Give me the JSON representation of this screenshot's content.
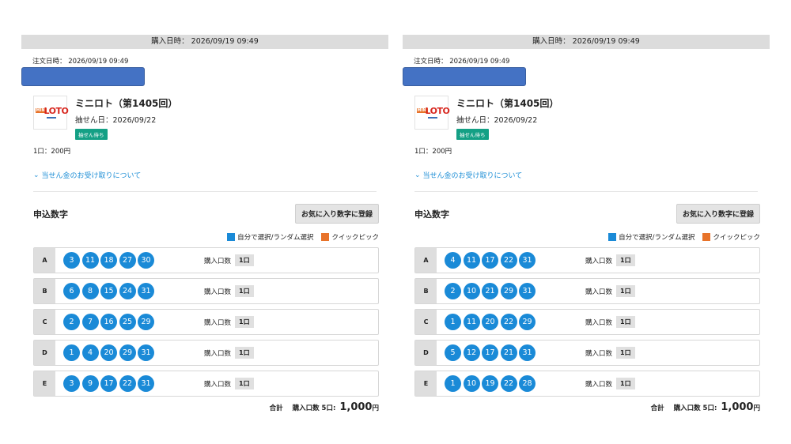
{
  "colors": {
    "ball": "#1a8ad7",
    "self_select": "#1a8ad7",
    "quick_pick": "#e8732a",
    "status_badge": "#14a085",
    "link": "#1f8fd6"
  },
  "panels": [
    {
      "purchase_datetime": "購入日時： 2026/09/19 09:49",
      "order_datetime": "注文日時： 2026/09/19 09:49",
      "logo_mini": "MINI",
      "logo_loto": "LOTO",
      "product_title": "ミニロト（第1405回）",
      "draw_date": "抽せん日：2026/09/22",
      "status": "抽せん待ち",
      "unit_price": "1口：200円",
      "prize_link": "当せん金のお受け取りについて",
      "section_title": "申込数字",
      "fav_button": "お気に入り数字に登録",
      "legend_self": "自分で選択/ランダム選択",
      "legend_quick": "クイックピック",
      "rows": [
        {
          "label": "A",
          "numbers": [
            "3",
            "11",
            "18",
            "27",
            "30"
          ],
          "qty_label": "購入口数",
          "qty": "1口"
        },
        {
          "label": "B",
          "numbers": [
            "6",
            "8",
            "15",
            "24",
            "31"
          ],
          "qty_label": "購入口数",
          "qty": "1口"
        },
        {
          "label": "C",
          "numbers": [
            "2",
            "7",
            "16",
            "25",
            "29"
          ],
          "qty_label": "購入口数",
          "qty": "1口"
        },
        {
          "label": "D",
          "numbers": [
            "1",
            "4",
            "20",
            "29",
            "31"
          ],
          "qty_label": "購入口数",
          "qty": "1口"
        },
        {
          "label": "E",
          "numbers": [
            "3",
            "9",
            "17",
            "22",
            "31"
          ],
          "qty_label": "購入口数",
          "qty": "1口"
        }
      ],
      "total_label": "合計",
      "total_qty": "購入口数 5口:",
      "total_amount": "1,000",
      "total_yen": "円"
    },
    {
      "purchase_datetime": "購入日時： 2026/09/19 09:49",
      "order_datetime": "注文日時： 2026/09/19 09:49",
      "logo_mini": "MINI",
      "logo_loto": "LOTO",
      "product_title": "ミニロト（第1405回）",
      "draw_date": "抽せん日：2026/09/22",
      "status": "抽せん待ち",
      "unit_price": "1口：200円",
      "prize_link": "当せん金のお受け取りについて",
      "section_title": "申込数字",
      "fav_button": "お気に入り数字に登録",
      "legend_self": "自分で選択/ランダム選択",
      "legend_quick": "クイックピック",
      "rows": [
        {
          "label": "A",
          "numbers": [
            "4",
            "11",
            "17",
            "22",
            "31"
          ],
          "qty_label": "購入口数",
          "qty": "1口"
        },
        {
          "label": "B",
          "numbers": [
            "2",
            "10",
            "21",
            "29",
            "31"
          ],
          "qty_label": "購入口数",
          "qty": "1口"
        },
        {
          "label": "C",
          "numbers": [
            "1",
            "11",
            "20",
            "22",
            "29"
          ],
          "qty_label": "購入口数",
          "qty": "1口"
        },
        {
          "label": "D",
          "numbers": [
            "5",
            "12",
            "17",
            "21",
            "31"
          ],
          "qty_label": "購入口数",
          "qty": "1口"
        },
        {
          "label": "E",
          "numbers": [
            "1",
            "10",
            "19",
            "22",
            "28"
          ],
          "qty_label": "購入口数",
          "qty": "1口"
        }
      ],
      "total_label": "合計",
      "total_qty": "購入口数 5口:",
      "total_amount": "1,000",
      "total_yen": "円"
    }
  ]
}
